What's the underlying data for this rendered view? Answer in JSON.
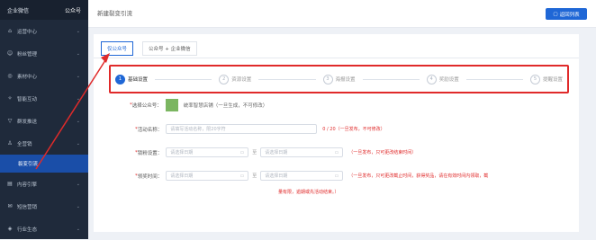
{
  "sidebar": {
    "tab_enterprise": "企业微信",
    "tab_official": "公众号",
    "items": [
      {
        "label": "运营中心",
        "icon": "home-icon",
        "glyph": "⌂"
      },
      {
        "label": "粉丝管理",
        "icon": "fans-icon",
        "glyph": "☺"
      },
      {
        "label": "素材中心",
        "icon": "material-icon",
        "glyph": "◎"
      },
      {
        "label": "智能互动",
        "icon": "interact-icon",
        "glyph": "✧"
      },
      {
        "label": "群发推送",
        "icon": "broadcast-icon",
        "glyph": "▽"
      },
      {
        "label": "全营销",
        "icon": "marketing-icon",
        "glyph": "♙"
      }
    ],
    "active_sub": "裂变引流",
    "items2": [
      {
        "label": "内容引擎",
        "icon": "content-icon",
        "glyph": "▤"
      },
      {
        "label": "短信营销",
        "icon": "sms-icon",
        "glyph": "✉"
      },
      {
        "label": "行业生态",
        "icon": "industry-icon",
        "glyph": "◈"
      }
    ]
  },
  "topbar": {
    "title": "新建裂变引流",
    "back_label": "返回列表"
  },
  "tabs": [
    "仅公众号",
    "公众号 + 企业微信"
  ],
  "steps": [
    {
      "num": "1",
      "label": "基础设置"
    },
    {
      "num": "2",
      "label": "资源设置"
    },
    {
      "num": "3",
      "label": "海报设置"
    },
    {
      "num": "4",
      "label": "奖励设置"
    },
    {
      "num": "5",
      "label": "提醒设置"
    }
  ],
  "form": {
    "official_label": "选择公众号：",
    "official_value": "统率智慧店铺（一旦生成，不可修改）",
    "name_label": "活动名称：",
    "name_placeholder": "请填写活动名称，限20字符",
    "name_count": "0 / 20（一旦发布，不可修改）",
    "fans_label": "锁粉设置：",
    "date_placeholder": "请选择日期",
    "sep": "至",
    "fans_hint": "（一旦发布，只可更改结束时间）",
    "reward_label": "领奖时间：",
    "reward_hint": "（一旦发布，只可更改截止时间，获得奖品，请在有效时间内领取，截",
    "reward_hint2": "量有限，逾期或先活动结束。）"
  },
  "colors": {
    "accent": "#1f67d6",
    "highlight": "#e02a2a",
    "sidebar": "#1f2a3b"
  }
}
